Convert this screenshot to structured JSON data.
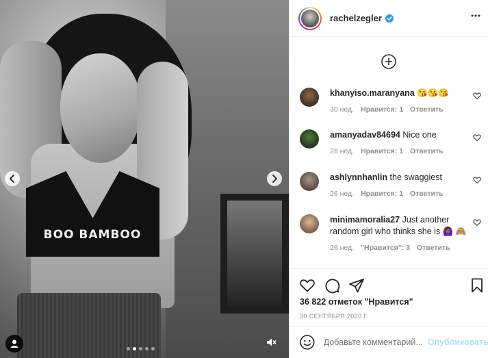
{
  "post": {
    "username": "rachelzegler",
    "verified": true,
    "image_text": "BOO BAMBOO",
    "carousel_count": 5,
    "carousel_index": 2
  },
  "comments": [
    {
      "user": "khanyiso.maranyana",
      "text": "😘😘😘",
      "time": "30 нед.",
      "likes": "Нравится: 1",
      "reply": "Ответить"
    },
    {
      "user": "amanyadav84694",
      "text": "Nice one",
      "time": "28 нед.",
      "likes": "Нравится: 1",
      "reply": "Ответить"
    },
    {
      "user": "ashlynnhanlin",
      "text": "the swaggiest",
      "time": "26 нед.",
      "likes": "Нравится: 1",
      "reply": "Ответить"
    },
    {
      "user": "minimamoralia27",
      "text": "Just another random girl who thinks she is 🙆🏾‍♀️ 🙈",
      "time": "26 нед.",
      "likes": "\"Нравится\": 3",
      "reply": "Ответить"
    }
  ],
  "likes_text": "36 822 отметок \"Нравится\"",
  "date": "30 СЕНТЯБРЯ 2020 Г.",
  "composer": {
    "placeholder": "Добавьте комментарий...",
    "post_label": "Опубликовать"
  },
  "colors": {
    "link": "#0095f6",
    "verified": "#3897f0",
    "muted": "#8e8e8e"
  }
}
